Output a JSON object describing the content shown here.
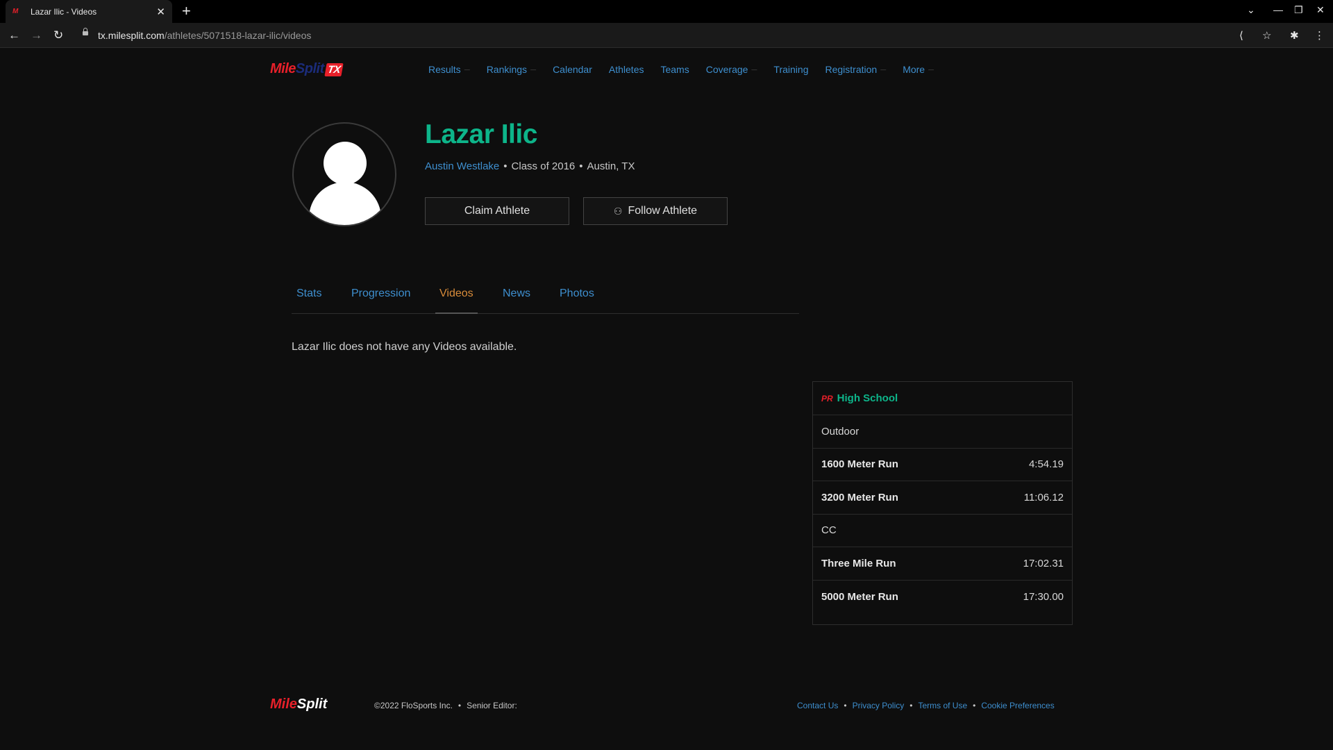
{
  "browser": {
    "tab_title": "Lazar Ilic - Videos",
    "favicon_text": "M",
    "url_host": "tx.milesplit.com",
    "url_path": "/athletes/5071518-lazar-ilic/videos"
  },
  "site": {
    "logo_mile": "Mile",
    "logo_split": "Split",
    "logo_state": "TX",
    "nav": [
      {
        "label": "Results"
      },
      {
        "label": "Rankings"
      },
      {
        "label": "Calendar"
      },
      {
        "label": "Athletes"
      },
      {
        "label": "Teams"
      },
      {
        "label": "Coverage"
      },
      {
        "label": "Training"
      },
      {
        "label": "Registration"
      },
      {
        "label": "More"
      }
    ]
  },
  "athlete": {
    "name": "Lazar Ilic",
    "school": "Austin Westlake",
    "class": "Class of 2016",
    "location": "Austin, TX",
    "claim_label": "Claim Athlete",
    "follow_label": "Follow Athlete"
  },
  "tabs": [
    {
      "label": "Stats"
    },
    {
      "label": "Progression"
    },
    {
      "label": "Videos"
    },
    {
      "label": "News"
    },
    {
      "label": "Photos"
    }
  ],
  "empty_message": "Lazar Ilic does not have any Videos available.",
  "pr_card": {
    "badge": "PR",
    "title": "High School",
    "sections": [
      {
        "name": "Outdoor",
        "events": [
          {
            "event": "1600 Meter Run",
            "time": "4:54.19"
          },
          {
            "event": "3200 Meter Run",
            "time": "11:06.12"
          }
        ]
      },
      {
        "name": "CC",
        "events": [
          {
            "event": "Three Mile Run",
            "time": "17:02.31"
          },
          {
            "event": "5000 Meter Run",
            "time": "17:30.00"
          }
        ]
      }
    ]
  },
  "footer": {
    "logo_mile": "Mile",
    "logo_split": "Split",
    "copyright": "©2022 FloSports Inc.",
    "editor": "Senior Editor:",
    "links": [
      "Contact Us",
      "Privacy Policy",
      "Terms of Use",
      "Cookie Preferences"
    ]
  }
}
